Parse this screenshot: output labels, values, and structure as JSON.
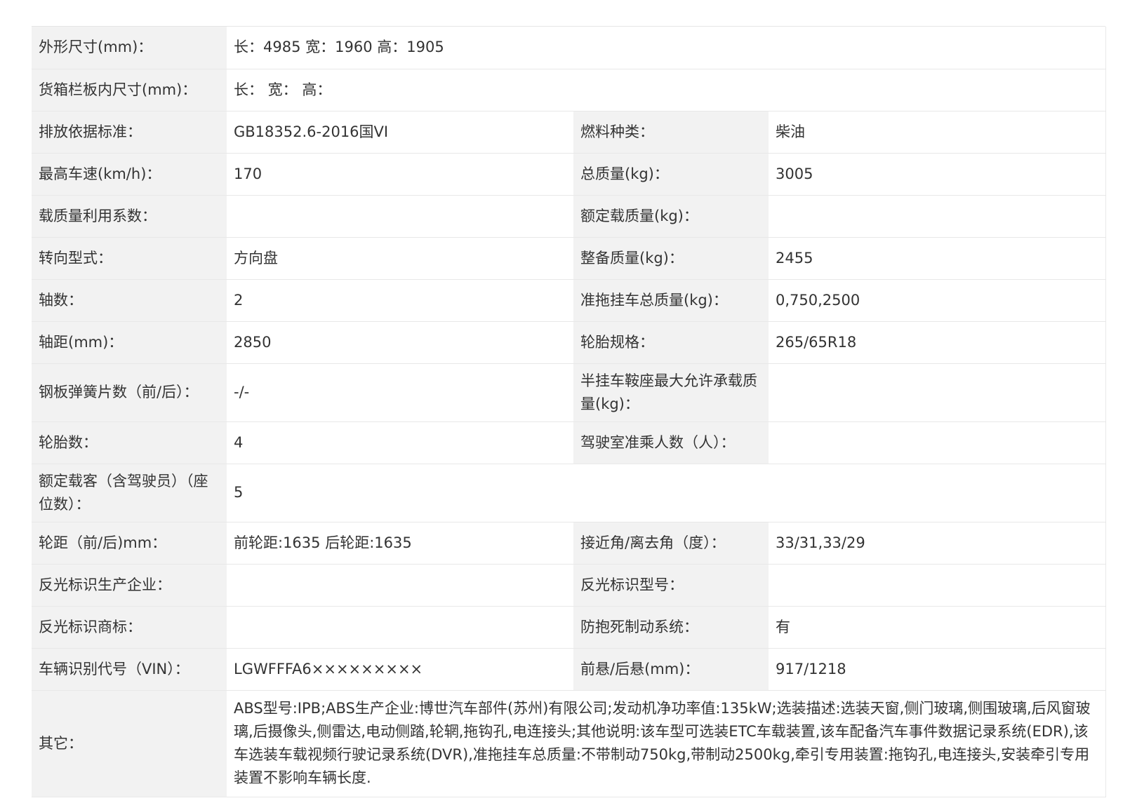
{
  "rows": [
    {
      "type": "full",
      "label": "外形尺寸(mm)：",
      "value": "长：4985 宽：1960 高：1905"
    },
    {
      "type": "full",
      "label": "货箱栏板内尺寸(mm)：",
      "value": "长：  宽：  高："
    },
    {
      "type": "pair",
      "label1": "排放依据标准：",
      "value1": "GB18352.6-2016国VI",
      "label2": "燃料种类：",
      "value2": "柴油"
    },
    {
      "type": "pair",
      "label1": "最高车速(km/h)：",
      "value1": "170",
      "label2": "总质量(kg)：",
      "value2": "3005"
    },
    {
      "type": "pair",
      "label1": "载质量利用系数：",
      "value1": "",
      "label2": "额定载质量(kg)：",
      "value2": ""
    },
    {
      "type": "pair",
      "label1": "转向型式：",
      "value1": "方向盘",
      "label2": "整备质量(kg)：",
      "value2": "2455"
    },
    {
      "type": "pair",
      "label1": "轴数：",
      "value1": "2",
      "label2": "准拖挂车总质量(kg)：",
      "value2": "0,750,2500"
    },
    {
      "type": "pair",
      "label1": "轴距(mm)：",
      "value1": "2850",
      "label2": "轮胎规格：",
      "value2": "265/65R18"
    },
    {
      "type": "pair",
      "tall": true,
      "label1": "钢板弹簧片数（前/后）：",
      "value1": "-/-",
      "label2": "半挂车鞍座最大允许承载质量(kg)：",
      "value2": ""
    },
    {
      "type": "pair",
      "label1": "轮胎数：",
      "value1": "4",
      "label2": "驾驶室准乘人数（人）：",
      "value2": ""
    },
    {
      "type": "full",
      "tall": true,
      "label": "额定载客（含驾驶员）（座位数）：",
      "value": "5"
    },
    {
      "type": "pair",
      "label1": "轮距（前/后)mm：",
      "value1": "前轮距:1635 后轮距:1635",
      "label2": "接近角/离去角（度）：",
      "value2": "33/31,33/29"
    },
    {
      "type": "pair",
      "label1": "反光标识生产企业：",
      "value1": "",
      "label2": "反光标识型号：",
      "value2": ""
    },
    {
      "type": "pair",
      "label1": "反光标识商标：",
      "value1": "",
      "label2": "防抱死制动系统：",
      "value2": "有"
    },
    {
      "type": "pair",
      "label1": "车辆识别代号（VIN）：",
      "value1": "LGWFFFA6×××××××××",
      "label2": "前悬/后悬(mm)：",
      "value2": "917/1218"
    },
    {
      "type": "full",
      "xtall": true,
      "label": "其它：",
      "value": "ABS型号:IPB;ABS生产企业:博世汽车部件(苏州)有限公司;发动机净功率值:135kW;选装描述:选装天窗,侧门玻璃,侧围玻璃,后风窗玻璃,后摄像头,侧雷达,电动侧踏,轮辋,拖钩孔,电连接头;其他说明:该车型可选装ETC车载装置,该车配备汽车事件数据记录系统(EDR),该车选装车载视频行驶记录系统(DVR),准拖挂车总质量:不带制动750kg,带制动2500kg,牵引专用装置:拖钩孔,电连接头,安装牵引专用装置不影响车辆长度."
    }
  ]
}
